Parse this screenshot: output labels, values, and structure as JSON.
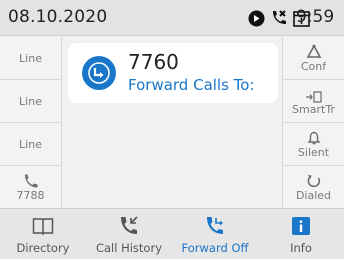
{
  "status_bar": {
    "date": "08.10.2020",
    "time": "9:59",
    "icons": [
      "do-not-disturb-icon",
      "missed-call-icon",
      "calendar-icon"
    ]
  },
  "left_keys": [
    {
      "label": "Line"
    },
    {
      "label": "Line"
    },
    {
      "label": "Line"
    },
    {
      "label": "7788",
      "icon": "phone-handset-icon"
    }
  ],
  "right_keys": [
    {
      "label": "Conf",
      "icon": "conference-icon"
    },
    {
      "label": "SmartTr",
      "icon": "smart-transfer-icon"
    },
    {
      "label": "Silent",
      "icon": "bell-icon"
    },
    {
      "label": "Dialed",
      "icon": "redial-icon"
    }
  ],
  "call_card": {
    "number": "7760",
    "status": "Forward Calls To:",
    "icon": "forward-icon"
  },
  "bottom_tabs": [
    {
      "label": "Directory",
      "icon": "book-icon"
    },
    {
      "label": "Call History",
      "icon": "call-history-icon"
    },
    {
      "label": "Forward Off",
      "icon": "forward-phone-icon",
      "active": true
    },
    {
      "label": "Info",
      "icon": "info-icon"
    }
  ],
  "colors": {
    "accent": "#1976c9",
    "text": "#222222",
    "muted": "#777777"
  }
}
